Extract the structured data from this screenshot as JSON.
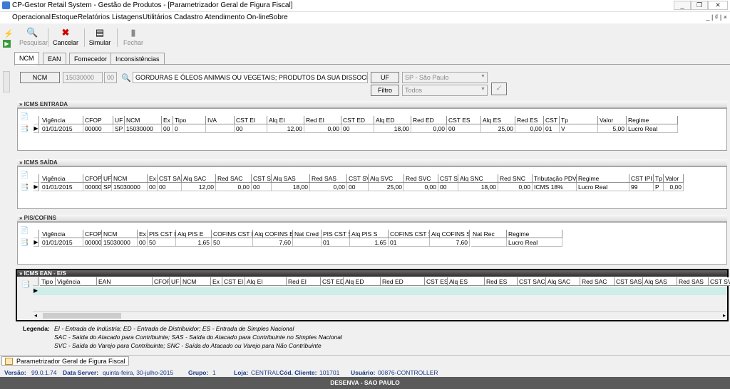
{
  "window": {
    "title": "CP-Gestor Retail System - Gestão de Produtos - [Parametrizador Geral de Figura Fiscal]",
    "minimize": "_",
    "restore": "❐",
    "close": "✕"
  },
  "menu": {
    "items": [
      "Operacional",
      "Estoque",
      "Relatórios",
      "Listagens",
      "Utilitários",
      "Cadastro",
      "Atendimento On-line",
      "Sobre"
    ],
    "mdi": "_ | ₫ | ×"
  },
  "toolbar": {
    "pesquisar": "Pesquisar",
    "cancelar": "Cancelar",
    "simular": "Simular",
    "fechar": "Fechar"
  },
  "tabs": [
    "NCM",
    "EAN",
    "Fornecedor",
    "Inconsistências"
  ],
  "filter": {
    "ncm_label": "NCM",
    "ncm_code": "15030000",
    "ncm_ex": "00",
    "ncm_desc": "GORDURAS E ÓLEOS ANIMAIS OU VEGETAIS; PRODUTOS DA SUA DISSOCIAÇÃO; G",
    "uf_label": "UF",
    "uf_value": "SP - São Paulo",
    "filtro_label": "Filtro",
    "filtro_value": "Todos"
  },
  "icms_entrada": {
    "title": "» ICMS ENTRADA",
    "headers": [
      "Vigência",
      "CFOP",
      "UF",
      "NCM",
      "Ex",
      "Tipo",
      "IVA",
      "CST EI",
      "Alq EI",
      "Red EI",
      "CST ED",
      "Alq ED",
      "Red ED",
      "CST ES",
      "Alq ES",
      "Red ES",
      "CST IPI",
      "Tp",
      "Valor",
      "Regime"
    ],
    "rows": [
      [
        "01/01/2015",
        "00000",
        "SP",
        "15030000",
        "00",
        "0",
        "",
        "00",
        "12,00",
        "0,00",
        "00",
        "18,00",
        "0,00",
        "00",
        "25,00",
        "0,00",
        "01",
        "V",
        "5,00",
        "Lucro Real"
      ]
    ]
  },
  "icms_saida": {
    "title": "» ICMS SAÍDA",
    "headers": [
      "Vigência",
      "CFOP",
      "UF",
      "NCM",
      "Ex",
      "CST SAC",
      "Alq SAC",
      "Red SAC",
      "CST SAS",
      "Alq SAS",
      "Red SAS",
      "CST SVC",
      "Alq SVC",
      "Red SVC",
      "CST SNC",
      "Alq SNC",
      "Red SNC",
      "Tributação PDV",
      "Regime",
      "CST IPI",
      "Tp",
      "Valor"
    ],
    "rows": [
      [
        "01/01/2015",
        "00000",
        "SP",
        "15030000",
        "00",
        "00",
        "12,00",
        "0,00",
        "00",
        "18,00",
        "0,00",
        "00",
        "25,00",
        "0,00",
        "00",
        "18,00",
        "0,00",
        "ICMS 18%",
        "Lucro Real",
        "99",
        "P",
        "0,00"
      ]
    ]
  },
  "pis_cofins": {
    "title": "» PIS/COFINS",
    "headers": [
      "Vigência",
      "CFOP",
      "NCM",
      "Ex",
      "PIS CST E",
      "Alq PIS E",
      "COFINS CST E",
      "Alq COFINS E",
      "Nat Cred",
      "PIS CST S",
      "Alq PIS S",
      "COFINS CST S",
      "Alq COFINS S",
      "Nat Rec",
      "Regime"
    ],
    "rows": [
      [
        "01/01/2015",
        "00000",
        "15030000",
        "00",
        "50",
        "1,65",
        "50",
        "7,60",
        "",
        "01",
        "1,65",
        "01",
        "7,60",
        "",
        "Lucro Real"
      ]
    ]
  },
  "icms_ean": {
    "title": "» ICMS EAN - E/S",
    "headers": [
      "Tipo",
      "Vigência",
      "EAN",
      "CFOP",
      "UF",
      "NCM",
      "Ex",
      "CST EI",
      "Alq EI",
      "Red EI",
      "CST ED",
      "Alq ED",
      "Red ED",
      "CST ES",
      "Alq ES",
      "Red ES",
      "CST SAC",
      "Alq SAC",
      "Red SAC",
      "CST SAS",
      "Alq SAS",
      "Red SAS",
      "CST SVC",
      "A"
    ]
  },
  "legend": {
    "title": "Legenda:",
    "lines": [
      "EI - Entrada de Indústria; ED - Entrada de Distribuidor; ES - Entrada de Simples Nacional",
      "SAC - Saída do Atacado para Contribuinte; SAS - Saída do Atacado para Contribuinte no Simples Nacional",
      "SVC - Saída do Varejo para Contribuinte; SNC - Saída do Atacado ou Varejo para Não Contribuinte"
    ]
  },
  "doc_tab": "Parametrizador Geral de Figura Fiscal",
  "status": {
    "versao_label": "Versão:",
    "versao": "99.0.1.74",
    "server_label": "Data Server:",
    "server": "quinta-feira, 30-julho-2015",
    "grupo_label": "Grupo:",
    "grupo": "1",
    "loja_label": "Loja:",
    "loja": "CENTRAL",
    "cliente_label": "Cód. Cliente:",
    "cliente": "101701",
    "usuario_label": "Usuário:",
    "usuario": "00876-CONTROLLER"
  },
  "footer": "DESENVA - SAO PAULO",
  "colors": {
    "accent": "#3a7bd5",
    "ean_selected_row": "#cfeee9",
    "cancel_icon": "#d40000",
    "frame": "#000000"
  }
}
